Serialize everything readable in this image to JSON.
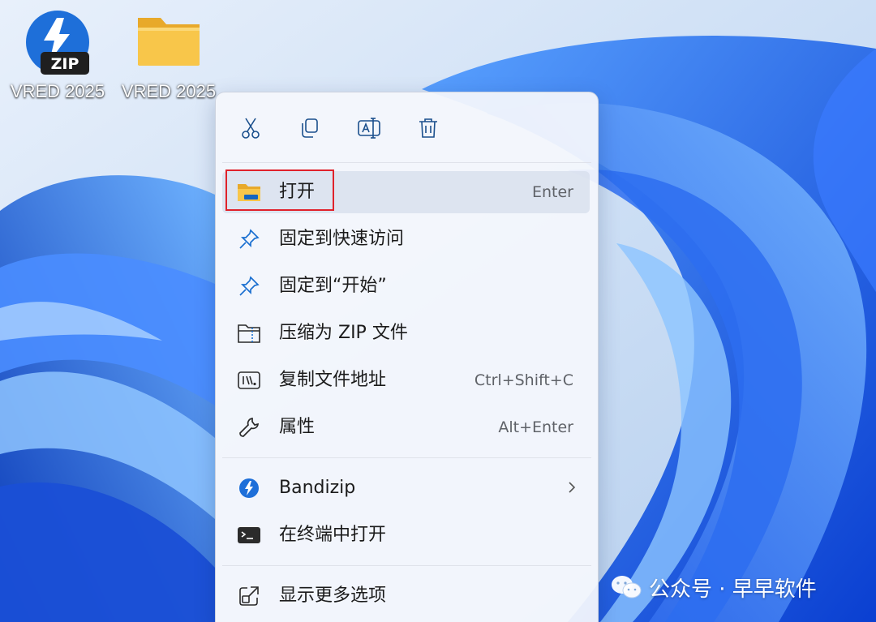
{
  "desktop": {
    "icons": [
      {
        "label": "VRED 2025",
        "badge": "ZIP",
        "icon": "bandizip-zip-icon"
      },
      {
        "label": "VRED 2025",
        "icon": "folder-icon"
      }
    ]
  },
  "context_menu": {
    "quick_actions": [
      {
        "name": "cut",
        "icon": "scissors-icon"
      },
      {
        "name": "copy",
        "icon": "copy-icon"
      },
      {
        "name": "rename",
        "icon": "rename-icon"
      },
      {
        "name": "delete",
        "icon": "trash-icon"
      }
    ],
    "items": [
      {
        "label": "打开",
        "shortcut": "Enter",
        "icon": "folder-open-icon"
      },
      {
        "label": "固定到快速访问",
        "shortcut": "",
        "icon": "pin-icon"
      },
      {
        "label": "固定到“开始”",
        "shortcut": "",
        "icon": "pin-icon"
      },
      {
        "label": "压缩为 ZIP 文件",
        "shortcut": "",
        "icon": "zip-folder-icon"
      },
      {
        "label": "复制文件地址",
        "shortcut": "Ctrl+Shift+C",
        "icon": "copy-path-icon"
      },
      {
        "label": "属性",
        "shortcut": "Alt+Enter",
        "icon": "wrench-icon"
      },
      {
        "label": "Bandizip",
        "shortcut": "",
        "icon": "bandizip-icon",
        "submenu": true
      },
      {
        "label": "在终端中打开",
        "shortcut": "",
        "icon": "terminal-icon"
      },
      {
        "label": "显示更多选项",
        "shortcut": "",
        "icon": "show-more-icon"
      }
    ]
  },
  "watermark": {
    "text": "公众号 · 早早软件",
    "icon": "wechat-icon"
  },
  "colors": {
    "accent": "#0067c0",
    "highlight_box": "#e0222b",
    "folder": "#f8c64a"
  }
}
